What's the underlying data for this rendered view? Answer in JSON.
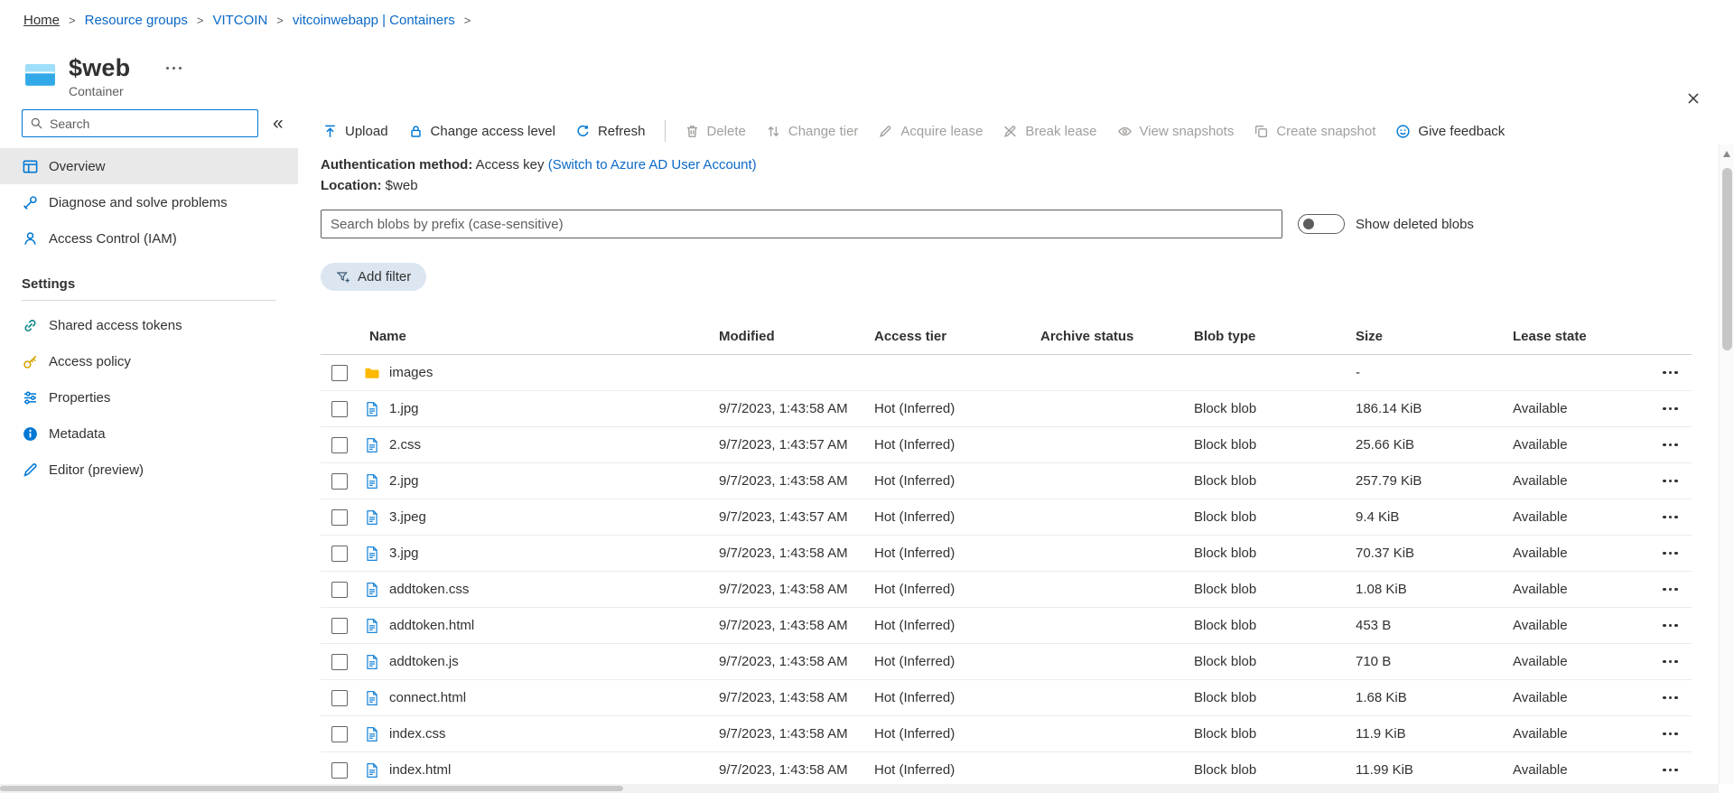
{
  "colors": {
    "accent": "#0078d4",
    "link": "#0b69c7",
    "disabled_text": "#a19f9d",
    "selected_nav_bg": "#e9e9e9",
    "folder_icon": "#ffb900",
    "add_filter_bg": "#dbe6f1"
  },
  "breadcrumb": {
    "separator": ">",
    "items": [
      "Home",
      "Resource groups",
      "VITCOIN",
      "vitcoinwebapp | Containers"
    ]
  },
  "header": {
    "title": "$web",
    "subtitle": "Container"
  },
  "sidebar": {
    "search_placeholder": "Search",
    "collapse_label": "«",
    "items": [
      {
        "label": "Overview"
      },
      {
        "label": "Diagnose and solve problems"
      },
      {
        "label": "Access Control (IAM)"
      }
    ],
    "settings_header": "Settings",
    "settings_items": [
      {
        "label": "Shared access tokens"
      },
      {
        "label": "Access policy"
      },
      {
        "label": "Properties"
      },
      {
        "label": "Metadata"
      },
      {
        "label": "Editor (preview)"
      }
    ]
  },
  "toolbar": {
    "upload": "Upload",
    "change_access_level": "Change access level",
    "refresh": "Refresh",
    "delete": "Delete",
    "change_tier": "Change tier",
    "acquire_lease": "Acquire lease",
    "break_lease": "Break lease",
    "view_snapshots": "View snapshots",
    "create_snapshot": "Create snapshot",
    "give_feedback": "Give feedback"
  },
  "info": {
    "auth_label": "Authentication method:",
    "auth_value": "Access key",
    "auth_link": "(Switch to Azure AD User Account)",
    "location_label": "Location:",
    "location_value": "$web"
  },
  "filters": {
    "search_placeholder": "Search blobs by prefix (case-sensitive)",
    "show_deleted_label": "Show deleted blobs",
    "add_filter_label": "Add filter"
  },
  "table": {
    "columns": [
      "Name",
      "Modified",
      "Access tier",
      "Archive status",
      "Blob type",
      "Size",
      "Lease state"
    ],
    "rows": [
      {
        "type": "folder",
        "name": "images",
        "modified": "",
        "access_tier": "",
        "archive_status": "",
        "blob_type": "",
        "size": "-",
        "lease_state": ""
      },
      {
        "type": "file",
        "name": "1.jpg",
        "modified": "9/7/2023, 1:43:58 AM",
        "access_tier": "Hot (Inferred)",
        "archive_status": "",
        "blob_type": "Block blob",
        "size": "186.14 KiB",
        "lease_state": "Available"
      },
      {
        "type": "file",
        "name": "2.css",
        "modified": "9/7/2023, 1:43:57 AM",
        "access_tier": "Hot (Inferred)",
        "archive_status": "",
        "blob_type": "Block blob",
        "size": "25.66 KiB",
        "lease_state": "Available"
      },
      {
        "type": "file",
        "name": "2.jpg",
        "modified": "9/7/2023, 1:43:58 AM",
        "access_tier": "Hot (Inferred)",
        "archive_status": "",
        "blob_type": "Block blob",
        "size": "257.79 KiB",
        "lease_state": "Available"
      },
      {
        "type": "file",
        "name": "3.jpeg",
        "modified": "9/7/2023, 1:43:57 AM",
        "access_tier": "Hot (Inferred)",
        "archive_status": "",
        "blob_type": "Block blob",
        "size": "9.4 KiB",
        "lease_state": "Available"
      },
      {
        "type": "file",
        "name": "3.jpg",
        "modified": "9/7/2023, 1:43:58 AM",
        "access_tier": "Hot (Inferred)",
        "archive_status": "",
        "blob_type": "Block blob",
        "size": "70.37 KiB",
        "lease_state": "Available"
      },
      {
        "type": "file",
        "name": "addtoken.css",
        "modified": "9/7/2023, 1:43:58 AM",
        "access_tier": "Hot (Inferred)",
        "archive_status": "",
        "blob_type": "Block blob",
        "size": "1.08 KiB",
        "lease_state": "Available"
      },
      {
        "type": "file",
        "name": "addtoken.html",
        "modified": "9/7/2023, 1:43:58 AM",
        "access_tier": "Hot (Inferred)",
        "archive_status": "",
        "blob_type": "Block blob",
        "size": "453 B",
        "lease_state": "Available"
      },
      {
        "type": "file",
        "name": "addtoken.js",
        "modified": "9/7/2023, 1:43:58 AM",
        "access_tier": "Hot (Inferred)",
        "archive_status": "",
        "blob_type": "Block blob",
        "size": "710 B",
        "lease_state": "Available"
      },
      {
        "type": "file",
        "name": "connect.html",
        "modified": "9/7/2023, 1:43:58 AM",
        "access_tier": "Hot (Inferred)",
        "archive_status": "",
        "blob_type": "Block blob",
        "size": "1.68 KiB",
        "lease_state": "Available"
      },
      {
        "type": "file",
        "name": "index.css",
        "modified": "9/7/2023, 1:43:58 AM",
        "access_tier": "Hot (Inferred)",
        "archive_status": "",
        "blob_type": "Block blob",
        "size": "11.9 KiB",
        "lease_state": "Available"
      },
      {
        "type": "file",
        "name": "index.html",
        "modified": "9/7/2023, 1:43:58 AM",
        "access_tier": "Hot (Inferred)",
        "archive_status": "",
        "blob_type": "Block blob",
        "size": "11.99 KiB",
        "lease_state": "Available"
      }
    ]
  }
}
